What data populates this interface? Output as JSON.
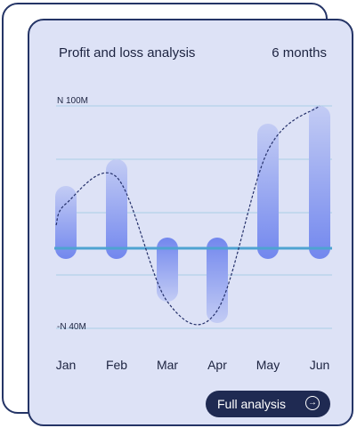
{
  "header": {
    "title": "Profit and loss analysis",
    "period": "6 months"
  },
  "chart_data": {
    "type": "bar",
    "categories": [
      "Jan",
      "Feb",
      "Mar",
      "Apr",
      "May",
      "Jun"
    ],
    "values": [
      35,
      50,
      -30,
      -42,
      70,
      80
    ],
    "trend": [
      25,
      40,
      -30,
      -35,
      55,
      80
    ],
    "ylim": [
      -47,
      88
    ],
    "y_tick_labels": [
      {
        "value": 80,
        "label": "N 100M"
      },
      {
        "value": -47,
        "label": "-N 40M"
      }
    ],
    "gridlines": [
      80,
      50,
      20,
      0,
      -15,
      -45
    ],
    "grid": true,
    "colors": {
      "bar": "#7b8ff0",
      "zero_line": "#4ea3d1",
      "trend": "#24306a",
      "grid": "#a9cfe6"
    }
  },
  "footer": {
    "button_label": "Full analysis",
    "button_icon": "arrow-right-circle-icon"
  }
}
